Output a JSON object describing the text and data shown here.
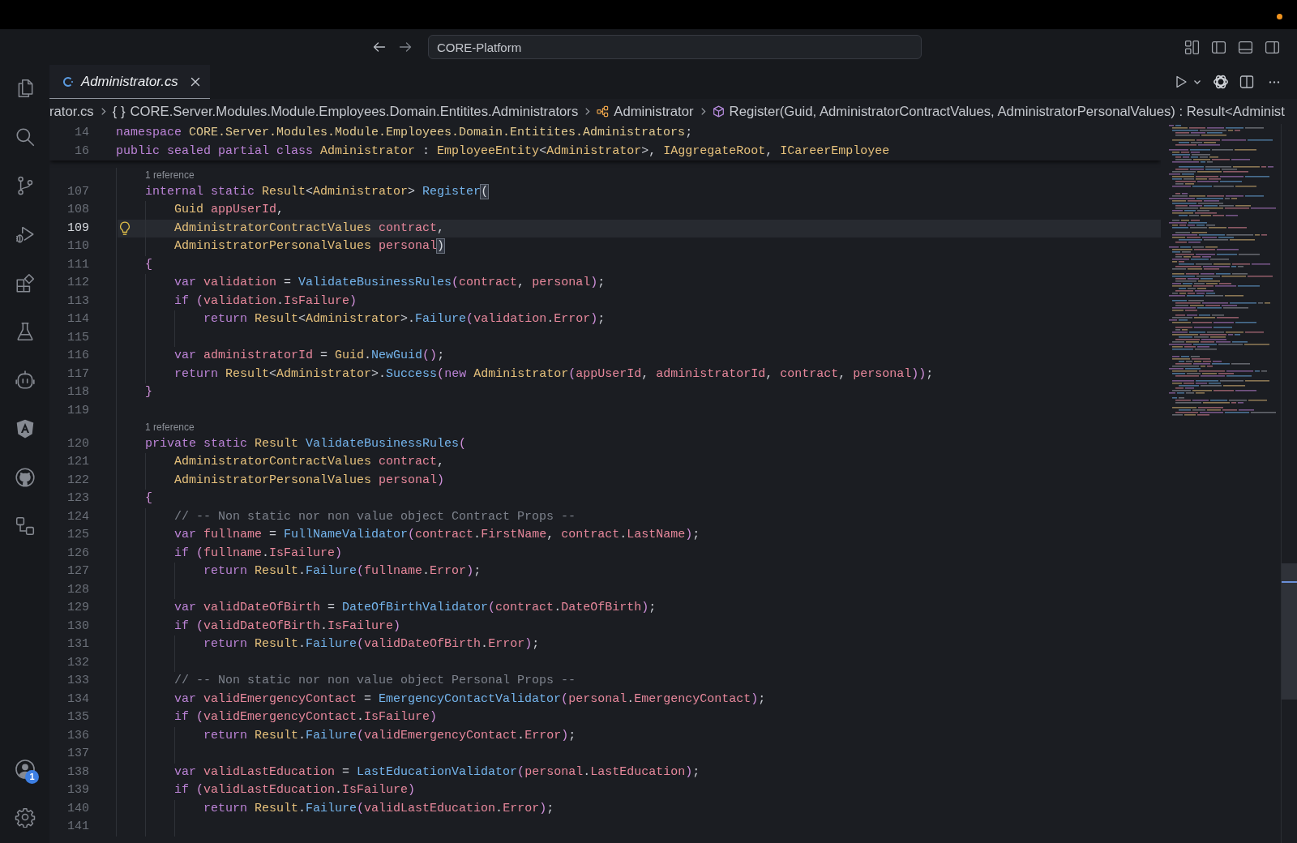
{
  "title_bar": {
    "command_center": "CORE-Platform"
  },
  "activity_bar": {
    "account_badge": "1"
  },
  "tabs": [
    {
      "label": "Administrator.cs",
      "selected": true,
      "preview": true
    }
  ],
  "breadcrumbs": [
    {
      "kind": "file",
      "text": "rator.cs"
    },
    {
      "kind": "namespace",
      "symbol": "{ }",
      "text": "CORE.Server.Modules.Module.Employees.Domain.Entitites.Administrators"
    },
    {
      "kind": "class",
      "text": "Administrator"
    },
    {
      "kind": "method",
      "text": "Register(Guid, AdministratorContractValues, AdministratorPersonalValues) : Result<Administ"
    }
  ],
  "editor": {
    "sticky_lines": [
      {
        "number": "14",
        "tokens": [
          {
            "text": "namespace ",
            "kind": "keyword"
          },
          {
            "text": "CORE.Server.Modules.Module.Employees.Domain.Entitites.Administrators",
            "kind": "namespace"
          },
          {
            "text": ";",
            "kind": "plain"
          }
        ]
      },
      {
        "number": "16",
        "tokens": [
          {
            "text": "public sealed partial class ",
            "kind": "keyword"
          },
          {
            "text": "Administrator",
            "kind": "type"
          },
          {
            "text": " : ",
            "kind": "plain"
          },
          {
            "text": "EmployeeEntity",
            "kind": "type"
          },
          {
            "text": "<",
            "kind": "plain"
          },
          {
            "text": "Administrator",
            "kind": "type"
          },
          {
            "text": ">, ",
            "kind": "plain"
          },
          {
            "text": "IAggregateRoot",
            "kind": "type"
          },
          {
            "text": ", ",
            "kind": "plain"
          },
          {
            "text": "ICareerEmployee",
            "kind": "type"
          }
        ]
      }
    ],
    "lines": [
      {
        "kind": "codelens",
        "text": "1 reference"
      },
      {
        "kind": "line",
        "number": "107",
        "current": false,
        "tokens": [
          {
            "text": "    internal static ",
            "kind": "keyword"
          },
          {
            "text": "Result",
            "kind": "type"
          },
          {
            "text": "<",
            "kind": "plain"
          },
          {
            "text": "Administrator",
            "kind": "type"
          },
          {
            "text": "> ",
            "kind": "plain"
          },
          {
            "text": "Register",
            "kind": "method"
          },
          {
            "text": "(",
            "kind": "match"
          }
        ]
      },
      {
        "kind": "line",
        "number": "108",
        "current": false,
        "tokens": [
          {
            "text": "        Guid",
            "kind": "type"
          },
          {
            "text": " appUserId",
            "kind": "variable"
          },
          {
            "text": ",",
            "kind": "plain"
          }
        ]
      },
      {
        "kind": "line",
        "number": "109",
        "current": true,
        "lightbulb": true,
        "tokens": [
          {
            "text": "        AdministratorContractValues",
            "kind": "type"
          },
          {
            "text": " contract",
            "kind": "variable"
          },
          {
            "text": ",",
            "kind": "plain"
          }
        ]
      },
      {
        "kind": "line",
        "number": "110",
        "current": false,
        "tokens": [
          {
            "text": "        AdministratorPersonalValues",
            "kind": "type"
          },
          {
            "text": " personal",
            "kind": "variable"
          },
          {
            "text": ")",
            "kind": "match"
          }
        ]
      },
      {
        "kind": "line",
        "number": "111",
        "current": false,
        "tokens": [
          {
            "text": "    {",
            "kind": "bracket"
          }
        ]
      },
      {
        "kind": "line",
        "number": "112",
        "current": false,
        "tokens": [
          {
            "text": "        var ",
            "kind": "keyword"
          },
          {
            "text": "validation",
            "kind": "variable"
          },
          {
            "text": " = ",
            "kind": "plain"
          },
          {
            "text": "ValidateBusinessRules",
            "kind": "method"
          },
          {
            "text": "(",
            "kind": "bracket"
          },
          {
            "text": "contract",
            "kind": "variable"
          },
          {
            "text": ", ",
            "kind": "plain"
          },
          {
            "text": "personal",
            "kind": "variable"
          },
          {
            "text": ")",
            "kind": "bracket"
          },
          {
            "text": ";",
            "kind": "plain"
          }
        ]
      },
      {
        "kind": "line",
        "number": "113",
        "current": false,
        "tokens": [
          {
            "text": "        if ",
            "kind": "keyword"
          },
          {
            "text": "(",
            "kind": "bracket"
          },
          {
            "text": "validation",
            "kind": "variable"
          },
          {
            "text": ".",
            "kind": "plain"
          },
          {
            "text": "IsFailure",
            "kind": "variable"
          },
          {
            "text": ")",
            "kind": "bracket"
          }
        ]
      },
      {
        "kind": "line",
        "number": "114",
        "current": false,
        "tokens": [
          {
            "text": "            return ",
            "kind": "keyword"
          },
          {
            "text": "Result",
            "kind": "type"
          },
          {
            "text": "<",
            "kind": "plain"
          },
          {
            "text": "Administrator",
            "kind": "type"
          },
          {
            "text": ">.",
            "kind": "plain"
          },
          {
            "text": "Failure",
            "kind": "method"
          },
          {
            "text": "(",
            "kind": "bracket"
          },
          {
            "text": "validation",
            "kind": "variable"
          },
          {
            "text": ".",
            "kind": "plain"
          },
          {
            "text": "Error",
            "kind": "variable"
          },
          {
            "text": ")",
            "kind": "bracket"
          },
          {
            "text": ";",
            "kind": "plain"
          }
        ]
      },
      {
        "kind": "line",
        "number": "115",
        "current": false
      },
      {
        "kind": "line",
        "number": "116",
        "current": false,
        "tokens": [
          {
            "text": "        var ",
            "kind": "keyword"
          },
          {
            "text": "administratorId",
            "kind": "variable"
          },
          {
            "text": " = ",
            "kind": "plain"
          },
          {
            "text": "Guid",
            "kind": "type"
          },
          {
            "text": ".",
            "kind": "plain"
          },
          {
            "text": "NewGuid",
            "kind": "method"
          },
          {
            "text": "()",
            "kind": "bracket"
          },
          {
            "text": ";",
            "kind": "plain"
          }
        ]
      },
      {
        "kind": "line",
        "number": "117",
        "current": false,
        "tokens": [
          {
            "text": "        return ",
            "kind": "keyword"
          },
          {
            "text": "Result",
            "kind": "type"
          },
          {
            "text": "<",
            "kind": "plain"
          },
          {
            "text": "Administrator",
            "kind": "type"
          },
          {
            "text": ">.",
            "kind": "plain"
          },
          {
            "text": "Success",
            "kind": "method"
          },
          {
            "text": "(",
            "kind": "bracket"
          },
          {
            "text": "new ",
            "kind": "keyword"
          },
          {
            "text": "Administrator",
            "kind": "type"
          },
          {
            "text": "(",
            "kind": "bracket"
          },
          {
            "text": "appUserId",
            "kind": "variable"
          },
          {
            "text": ", ",
            "kind": "plain"
          },
          {
            "text": "administratorId",
            "kind": "variable"
          },
          {
            "text": ", ",
            "kind": "plain"
          },
          {
            "text": "contract",
            "kind": "variable"
          },
          {
            "text": ", ",
            "kind": "plain"
          },
          {
            "text": "personal",
            "kind": "variable"
          },
          {
            "text": "))",
            "kind": "bracket"
          },
          {
            "text": ";",
            "kind": "plain"
          }
        ]
      },
      {
        "kind": "line",
        "number": "118",
        "current": false,
        "tokens": [
          {
            "text": "    }",
            "kind": "bracket"
          }
        ]
      },
      {
        "kind": "line",
        "number": "119",
        "current": false
      },
      {
        "kind": "codelens",
        "text": "1 reference"
      },
      {
        "kind": "line",
        "number": "120",
        "current": false,
        "tokens": [
          {
            "text": "    private static ",
            "kind": "keyword"
          },
          {
            "text": "Result ",
            "kind": "type"
          },
          {
            "text": "ValidateBusinessRules",
            "kind": "method"
          },
          {
            "text": "(",
            "kind": "bracket"
          }
        ]
      },
      {
        "kind": "line",
        "number": "121",
        "current": false,
        "tokens": [
          {
            "text": "        AdministratorContractValues",
            "kind": "type"
          },
          {
            "text": " contract",
            "kind": "variable"
          },
          {
            "text": ",",
            "kind": "plain"
          }
        ]
      },
      {
        "kind": "line",
        "number": "122",
        "current": false,
        "tokens": [
          {
            "text": "        AdministratorPersonalValues",
            "kind": "type"
          },
          {
            "text": " personal",
            "kind": "variable"
          },
          {
            "text": ")",
            "kind": "bracket"
          }
        ]
      },
      {
        "kind": "line",
        "number": "123",
        "current": false,
        "tokens": [
          {
            "text": "    {",
            "kind": "bracket"
          }
        ]
      },
      {
        "kind": "line",
        "number": "124",
        "current": false,
        "tokens": [
          {
            "text": "        // -- Non static nor non value object Contract Props --",
            "kind": "comment"
          }
        ]
      },
      {
        "kind": "line",
        "number": "125",
        "current": false,
        "tokens": [
          {
            "text": "        var ",
            "kind": "keyword"
          },
          {
            "text": "fullname",
            "kind": "variable"
          },
          {
            "text": " = ",
            "kind": "plain"
          },
          {
            "text": "FullNameValidator",
            "kind": "method"
          },
          {
            "text": "(",
            "kind": "bracket"
          },
          {
            "text": "contract",
            "kind": "variable"
          },
          {
            "text": ".",
            "kind": "plain"
          },
          {
            "text": "FirstName",
            "kind": "variable"
          },
          {
            "text": ", ",
            "kind": "plain"
          },
          {
            "text": "contract",
            "kind": "variable"
          },
          {
            "text": ".",
            "kind": "plain"
          },
          {
            "text": "LastName",
            "kind": "variable"
          },
          {
            "text": ")",
            "kind": "bracket"
          },
          {
            "text": ";",
            "kind": "plain"
          }
        ]
      },
      {
        "kind": "line",
        "number": "126",
        "current": false,
        "tokens": [
          {
            "text": "        if ",
            "kind": "keyword"
          },
          {
            "text": "(",
            "kind": "bracket"
          },
          {
            "text": "fullname",
            "kind": "variable"
          },
          {
            "text": ".",
            "kind": "plain"
          },
          {
            "text": "IsFailure",
            "kind": "variable"
          },
          {
            "text": ")",
            "kind": "bracket"
          }
        ]
      },
      {
        "kind": "line",
        "number": "127",
        "current": false,
        "tokens": [
          {
            "text": "            return ",
            "kind": "keyword"
          },
          {
            "text": "Result",
            "kind": "type"
          },
          {
            "text": ".",
            "kind": "plain"
          },
          {
            "text": "Failure",
            "kind": "method"
          },
          {
            "text": "(",
            "kind": "bracket"
          },
          {
            "text": "fullname",
            "kind": "variable"
          },
          {
            "text": ".",
            "kind": "plain"
          },
          {
            "text": "Error",
            "kind": "variable"
          },
          {
            "text": ")",
            "kind": "bracket"
          },
          {
            "text": ";",
            "kind": "plain"
          }
        ]
      },
      {
        "kind": "line",
        "number": "128",
        "current": false
      },
      {
        "kind": "line",
        "number": "129",
        "current": false,
        "tokens": [
          {
            "text": "        var ",
            "kind": "keyword"
          },
          {
            "text": "validDateOfBirth",
            "kind": "variable"
          },
          {
            "text": " = ",
            "kind": "plain"
          },
          {
            "text": "DateOfBirthValidator",
            "kind": "method"
          },
          {
            "text": "(",
            "kind": "bracket"
          },
          {
            "text": "contract",
            "kind": "variable"
          },
          {
            "text": ".",
            "kind": "plain"
          },
          {
            "text": "DateOfBirth",
            "kind": "variable"
          },
          {
            "text": ")",
            "kind": "bracket"
          },
          {
            "text": ";",
            "kind": "plain"
          }
        ]
      },
      {
        "kind": "line",
        "number": "130",
        "current": false,
        "tokens": [
          {
            "text": "        if ",
            "kind": "keyword"
          },
          {
            "text": "(",
            "kind": "bracket"
          },
          {
            "text": "validDateOfBirth",
            "kind": "variable"
          },
          {
            "text": ".",
            "kind": "plain"
          },
          {
            "text": "IsFailure",
            "kind": "variable"
          },
          {
            "text": ")",
            "kind": "bracket"
          }
        ]
      },
      {
        "kind": "line",
        "number": "131",
        "current": false,
        "tokens": [
          {
            "text": "            return ",
            "kind": "keyword"
          },
          {
            "text": "Result",
            "kind": "type"
          },
          {
            "text": ".",
            "kind": "plain"
          },
          {
            "text": "Failure",
            "kind": "method"
          },
          {
            "text": "(",
            "kind": "bracket"
          },
          {
            "text": "validDateOfBirth",
            "kind": "variable"
          },
          {
            "text": ".",
            "kind": "plain"
          },
          {
            "text": "Error",
            "kind": "variable"
          },
          {
            "text": ")",
            "kind": "bracket"
          },
          {
            "text": ";",
            "kind": "plain"
          }
        ]
      },
      {
        "kind": "line",
        "number": "132",
        "current": false
      },
      {
        "kind": "line",
        "number": "133",
        "current": false,
        "tokens": [
          {
            "text": "        // -- Non static nor non value object Personal Props --",
            "kind": "comment"
          }
        ]
      },
      {
        "kind": "line",
        "number": "134",
        "current": false,
        "tokens": [
          {
            "text": "        var ",
            "kind": "keyword"
          },
          {
            "text": "validEmergencyContact",
            "kind": "variable"
          },
          {
            "text": " = ",
            "kind": "plain"
          },
          {
            "text": "EmergencyContactValidator",
            "kind": "method"
          },
          {
            "text": "(",
            "kind": "bracket"
          },
          {
            "text": "personal",
            "kind": "variable"
          },
          {
            "text": ".",
            "kind": "plain"
          },
          {
            "text": "EmergencyContact",
            "kind": "variable"
          },
          {
            "text": ")",
            "kind": "bracket"
          },
          {
            "text": ";",
            "kind": "plain"
          }
        ]
      },
      {
        "kind": "line",
        "number": "135",
        "current": false,
        "tokens": [
          {
            "text": "        if ",
            "kind": "keyword"
          },
          {
            "text": "(",
            "kind": "bracket"
          },
          {
            "text": "validEmergencyContact",
            "kind": "variable"
          },
          {
            "text": ".",
            "kind": "plain"
          },
          {
            "text": "IsFailure",
            "kind": "variable"
          },
          {
            "text": ")",
            "kind": "bracket"
          }
        ]
      },
      {
        "kind": "line",
        "number": "136",
        "current": false,
        "tokens": [
          {
            "text": "            return ",
            "kind": "keyword"
          },
          {
            "text": "Result",
            "kind": "type"
          },
          {
            "text": ".",
            "kind": "plain"
          },
          {
            "text": "Failure",
            "kind": "method"
          },
          {
            "text": "(",
            "kind": "bracket"
          },
          {
            "text": "validEmergencyContact",
            "kind": "variable"
          },
          {
            "text": ".",
            "kind": "plain"
          },
          {
            "text": "Error",
            "kind": "variable"
          },
          {
            "text": ")",
            "kind": "bracket"
          },
          {
            "text": ";",
            "kind": "plain"
          }
        ]
      },
      {
        "kind": "line",
        "number": "137",
        "current": false
      },
      {
        "kind": "line",
        "number": "138",
        "current": false,
        "tokens": [
          {
            "text": "        var ",
            "kind": "keyword"
          },
          {
            "text": "validLastEducation",
            "kind": "variable"
          },
          {
            "text": " = ",
            "kind": "plain"
          },
          {
            "text": "LastEducationValidator",
            "kind": "method"
          },
          {
            "text": "(",
            "kind": "bracket"
          },
          {
            "text": "personal",
            "kind": "variable"
          },
          {
            "text": ".",
            "kind": "plain"
          },
          {
            "text": "LastEducation",
            "kind": "variable"
          },
          {
            "text": ")",
            "kind": "bracket"
          },
          {
            "text": ";",
            "kind": "plain"
          }
        ]
      },
      {
        "kind": "line",
        "number": "139",
        "current": false,
        "tokens": [
          {
            "text": "        if ",
            "kind": "keyword"
          },
          {
            "text": "(",
            "kind": "bracket"
          },
          {
            "text": "validLastEducation",
            "kind": "variable"
          },
          {
            "text": ".",
            "kind": "plain"
          },
          {
            "text": "IsFailure",
            "kind": "variable"
          },
          {
            "text": ")",
            "kind": "bracket"
          }
        ]
      },
      {
        "kind": "line",
        "number": "140",
        "current": false,
        "tokens": [
          {
            "text": "            return ",
            "kind": "keyword"
          },
          {
            "text": "Result",
            "kind": "type"
          },
          {
            "text": ".",
            "kind": "plain"
          },
          {
            "text": "Failure",
            "kind": "method"
          },
          {
            "text": "(",
            "kind": "bracket"
          },
          {
            "text": "validLastEducation",
            "kind": "variable"
          },
          {
            "text": ".",
            "kind": "plain"
          },
          {
            "text": "Error",
            "kind": "variable"
          },
          {
            "text": ")",
            "kind": "bracket"
          },
          {
            "text": ";",
            "kind": "plain"
          }
        ]
      },
      {
        "kind": "line",
        "number": "141",
        "current": false
      }
    ]
  }
}
